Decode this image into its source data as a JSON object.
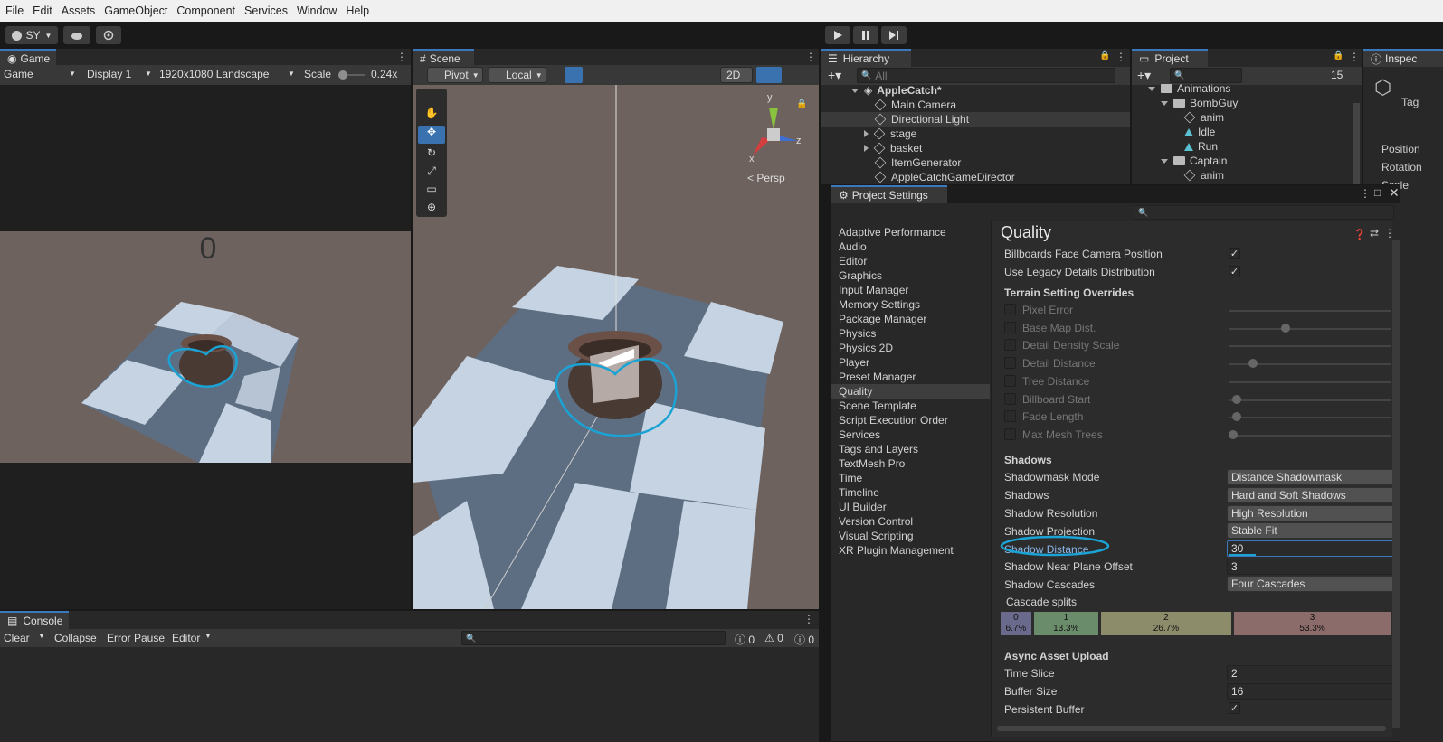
{
  "menu": [
    "File",
    "Edit",
    "Assets",
    "GameObject",
    "Component",
    "Services",
    "Window",
    "Help"
  ],
  "toolbar": {
    "account": "SY"
  },
  "game": {
    "tab": "Game",
    "view_dropdown": "Game",
    "display": "Display 1",
    "resolution": "1920x1080 Landscape",
    "scale_label": "Scale",
    "scale_value": "0.24x",
    "score": "0"
  },
  "scene": {
    "tab": "Scene",
    "pivot": "Pivot",
    "local": "Local",
    "mode2d": "2D",
    "persp": "Persp",
    "gizmo_y": "y",
    "gizmo_x": "x",
    "gizmo_z": "z"
  },
  "hierarchy": {
    "tab": "Hierarchy",
    "search_placeholder": "All",
    "scene_name": "AppleCatch*",
    "items": [
      "Main Camera",
      "Directional Light",
      "stage",
      "basket",
      "ItemGenerator",
      "AppleCatchGameDirector"
    ]
  },
  "project": {
    "tab": "Project",
    "badge": "15",
    "items": [
      "Animations",
      "BombGuy",
      "anim",
      "Idle",
      "Run",
      "Captain",
      "anim"
    ]
  },
  "inspector": {
    "tab": "Inspec",
    "tag": "Tag",
    "position": "Position",
    "rotation": "Rotation",
    "scale": "Scale"
  },
  "project_settings": {
    "title": "Project Settings",
    "categories": [
      "Adaptive Performance",
      "Audio",
      "Editor",
      "Graphics",
      "Input Manager",
      "Memory Settings",
      "Package Manager",
      "Physics",
      "Physics 2D",
      "Player",
      "Preset Manager",
      "Quality",
      "Scene Template",
      "Script Execution Order",
      "Services",
      "Tags and Layers",
      "TextMesh Pro",
      "Time",
      "Timeline",
      "UI Builder",
      "Version Control",
      "Visual Scripting",
      "XR Plugin Management"
    ],
    "selected": "Quality",
    "heading": "Quality",
    "billboards_face": "Billboards Face Camera Position",
    "legacy_details": "Use Legacy Details Distribution",
    "terrain_header": "Terrain Setting Overrides",
    "terrain_items": [
      "Pixel Error",
      "Base Map Dist.",
      "Detail Density Scale",
      "Detail Distance",
      "Tree Distance",
      "Billboard Start",
      "Fade Length",
      "Max Mesh Trees"
    ],
    "shadows_header": "Shadows",
    "shadowmask_mode": {
      "label": "Shadowmask Mode",
      "value": "Distance Shadowmask"
    },
    "shadows": {
      "label": "Shadows",
      "value": "Hard and Soft Shadows"
    },
    "shadow_resolution": {
      "label": "Shadow Resolution",
      "value": "High Resolution"
    },
    "shadow_projection": {
      "label": "Shadow Projection",
      "value": "Stable Fit"
    },
    "shadow_distance": {
      "label": "Shadow Distance",
      "value": "30"
    },
    "shadow_near": {
      "label": "Shadow Near Plane Offset",
      "value": "3"
    },
    "shadow_cascades": {
      "label": "Shadow Cascades",
      "value": "Four Cascades"
    },
    "cascade_splits_label": "Cascade splits",
    "cascades": [
      {
        "idx": "0",
        "pct": "6.7%",
        "color": "#6a6a8c"
      },
      {
        "idx": "1",
        "pct": "13.3%",
        "color": "#6b8c6b"
      },
      {
        "idx": "2",
        "pct": "26.7%",
        "color": "#8c8c6b"
      },
      {
        "idx": "3",
        "pct": "53.3%",
        "color": "#8c6b6b"
      }
    ],
    "async_header": "Async Asset Upload",
    "time_slice": {
      "label": "Time Slice",
      "value": "2"
    },
    "buffer_size": {
      "label": "Buffer Size",
      "value": "16"
    },
    "persistent_buffer": {
      "label": "Persistent Buffer"
    }
  },
  "console": {
    "tab": "Console",
    "clear": "Clear",
    "collapse": "Collapse",
    "error_pause": "Error Pause",
    "editor": "Editor",
    "count_logs": "0",
    "count_warnings": "0",
    "count_errors": "0"
  },
  "annotation_color": "#1aa3d4"
}
